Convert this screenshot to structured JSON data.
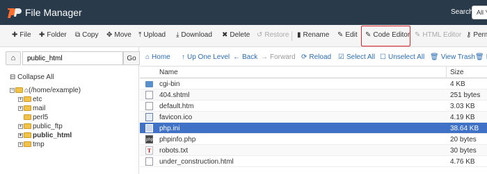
{
  "header": {
    "title": "File Manager",
    "search_label": "Search",
    "search_value": "All Y"
  },
  "toolbar": {
    "buttons": [
      {
        "label": "File",
        "icon": "plus-icon"
      },
      {
        "label": "Folder",
        "icon": "plus-icon"
      },
      {
        "label": "Copy",
        "icon": "copy-icon"
      },
      {
        "label": "Move",
        "icon": "move-icon"
      },
      {
        "label": "Upload",
        "icon": "upload-icon"
      },
      {
        "label": "Download",
        "icon": "download-icon"
      },
      {
        "label": "Delete",
        "icon": "close-icon"
      },
      {
        "label": "Restore",
        "icon": "restore-icon"
      },
      {
        "label": "Rename",
        "icon": "rename-icon"
      },
      {
        "label": "Edit",
        "icon": "pencil-icon"
      },
      {
        "label": "Code Editor",
        "icon": "code-editor-icon"
      },
      {
        "label": "HTML Editor",
        "icon": "html-editor-icon"
      },
      {
        "label": "Perm",
        "icon": "key-icon"
      }
    ],
    "highlight_color": "#d9232d"
  },
  "left": {
    "path_value": "public_html",
    "go_label": "Go",
    "collapse_all": "Collapse All",
    "root": "(/home/example)",
    "folders": [
      "etc",
      "mail",
      "perl5",
      "public_ftp",
      "public_html",
      "tmp"
    ]
  },
  "nav": {
    "buttons": [
      {
        "label": "Home",
        "icon": "home-icon"
      },
      {
        "label": "Up One Level",
        "icon": "up-arrow-icon"
      },
      {
        "label": "Back",
        "icon": "back-arrow-icon"
      },
      {
        "label": "Forward",
        "icon": "forward-arrow-icon"
      },
      {
        "label": "Reload",
        "icon": "reload-icon"
      },
      {
        "label": "Select All",
        "icon": "check-icon"
      },
      {
        "label": "Unselect All",
        "icon": "square-icon"
      },
      {
        "label": "View Trash",
        "icon": "trash-icon"
      },
      {
        "label": "E",
        "icon": "trash-icon"
      }
    ]
  },
  "table": {
    "headers": {
      "name": "Name",
      "size": "Size"
    },
    "rows": [
      {
        "name": "cgi-bin",
        "size": "4 KB",
        "type": "folder"
      },
      {
        "name": "404.shtml",
        "size": "251 bytes",
        "type": "doc"
      },
      {
        "name": "default.htm",
        "size": "3.03 KB",
        "type": "doc"
      },
      {
        "name": "favicon.ico",
        "size": "4.19 KB",
        "type": "img"
      },
      {
        "name": "php.ini",
        "size": "38.64 KB",
        "type": "ini",
        "selected": true
      },
      {
        "name": "phpinfo.php",
        "size": "20 bytes",
        "type": "php"
      },
      {
        "name": "robots.txt",
        "size": "30 bytes",
        "type": "text"
      },
      {
        "name": "under_construction.html",
        "size": "4.76 KB",
        "type": "doc"
      }
    ]
  },
  "colors": {
    "topbar": "#293a4a",
    "selected_row": "#3f72c6",
    "link": "#2a6db5"
  }
}
